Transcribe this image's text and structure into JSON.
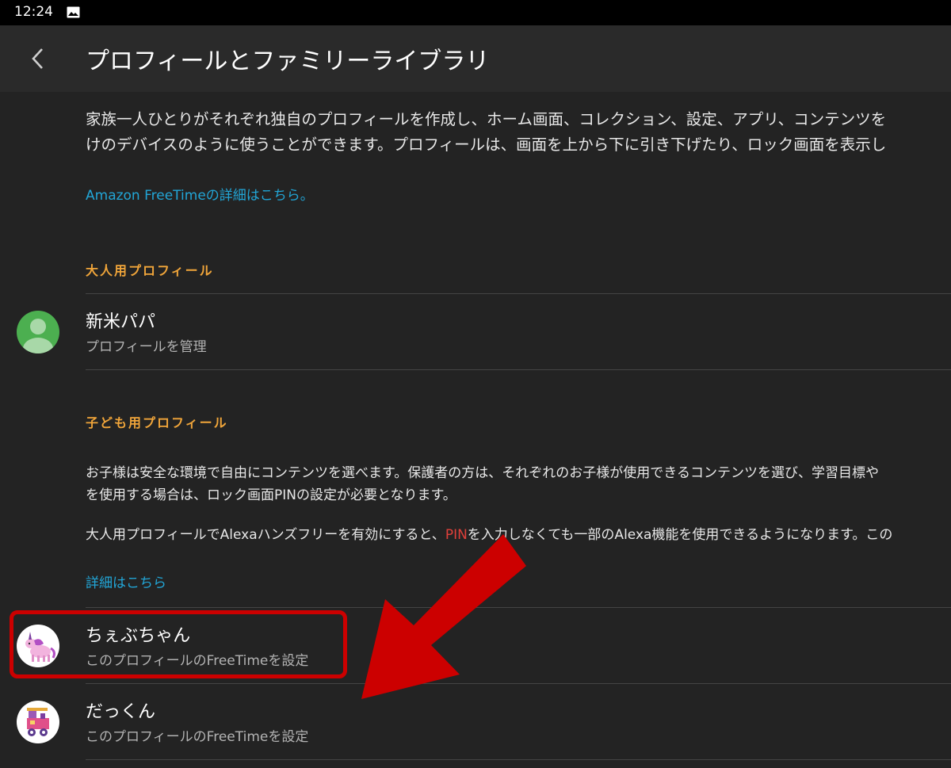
{
  "status_bar": {
    "time": "12:24"
  },
  "header": {
    "title": "プロフィールとファミリーライブラリ"
  },
  "intro": {
    "line1": "家族一人ひとりがそれぞれ独自のプロフィールを作成し、ホーム画面、コレクション、設定、アプリ、コンテンツを",
    "line2": "けのデバイスのように使うことができます。プロフィールは、画面を上から下に引き下げたり、ロック画面を表示し",
    "link": "Amazon FreeTimeの詳細はこちら。"
  },
  "adult_section": {
    "header": "大人用プロフィール",
    "profiles": [
      {
        "name": "新米パパ",
        "subtitle": "プロフィールを管理"
      }
    ]
  },
  "child_section": {
    "header": "子ども用プロフィール",
    "desc_line1": "お子様は安全な環境で自由にコンテンツを選べます。保護者の方は、それぞれのお子様が使用できるコンテンツを選び、学習目標や",
    "desc_line2": "を使用する場合は、ロック画面PINの設定が必要となります。",
    "alexa_before": "大人用プロフィールでAlexaハンズフリーを有効にすると、",
    "alexa_pin": "PIN",
    "alexa_after": "を入力しなくても一部のAlexa機能を使用できるようになります。この",
    "link": "詳細はこちら",
    "profiles": [
      {
        "name": "ちぇぶちゃん",
        "subtitle": "このプロフィールのFreeTimeを設定"
      },
      {
        "name": "だっくん",
        "subtitle": "このプロフィールのFreeTimeを設定"
      }
    ]
  },
  "colors": {
    "background": "#232323",
    "app_bar": "#2a2a2a",
    "section_header": "#f0a53a",
    "link": "#22a6d7",
    "highlight": "#cc0000",
    "adult_avatar": "#4caf50"
  },
  "icons": {
    "back": "chevron-left-icon",
    "status_image": "image-icon",
    "adult_avatar": "person-icon",
    "child1_avatar": "unicorn-icon",
    "child2_avatar": "train-icon"
  }
}
